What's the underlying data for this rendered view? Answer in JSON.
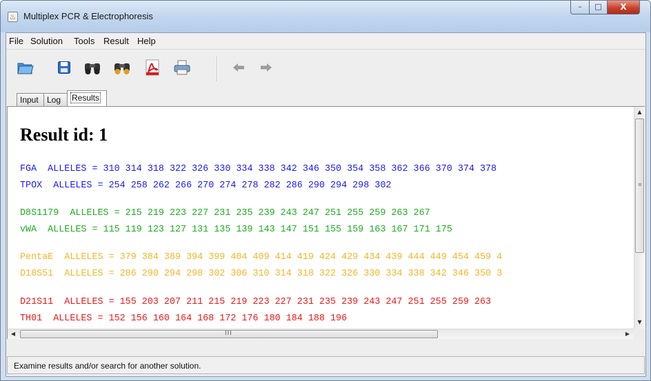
{
  "window": {
    "title": "Multiplex PCR & Electrophoresis",
    "controls": {
      "minimize": "–",
      "maximize": "□",
      "close": "X"
    }
  },
  "menubar": {
    "items": [
      {
        "label": "File"
      },
      {
        "label": "Solution"
      },
      {
        "label": "Tools"
      },
      {
        "label": "Result"
      },
      {
        "label": "Help"
      }
    ]
  },
  "toolbar": {
    "buttons": [
      {
        "icon": "open-folder-icon"
      },
      {
        "icon": "save-icon"
      },
      {
        "icon": "binoculars-icon"
      },
      {
        "icon": "binoculars-next-icon"
      },
      {
        "icon": "pdf-icon"
      },
      {
        "icon": "printer-icon"
      },
      {
        "icon": "back-arrow-icon"
      },
      {
        "icon": "forward-arrow-icon"
      }
    ]
  },
  "tabs": [
    {
      "label": "Input",
      "active": false
    },
    {
      "label": "Log",
      "active": false
    },
    {
      "label": "Results",
      "active": true
    }
  ],
  "results": {
    "heading": "Result id: 1",
    "groups": [
      {
        "color": "#1a1aff",
        "lines": [
          "FGA  ALLELES = 310 314 318 322 326 330 334 338 342 346 350 354 358 362 366 370 374 378",
          "TPOX  ALLELES = 254 258 262 266 270 274 278 282 286 290 294 298 302"
        ]
      },
      {
        "color": "#1eae1e",
        "lines": [
          "D8S1179  ALLELES = 215 219 223 227 231 235 239 243 247 251 255 259 263 267",
          "vWA  ALLELES = 115 119 123 127 131 135 139 143 147 151 155 159 163 167 171 175"
        ]
      },
      {
        "color": "#f3b62a",
        "lines": [
          "PentaE  ALLELES = 379 384 389 394 399 404 409 414 419 424 429 434 439 444 449 454 459 4",
          "D18S51  ALLELES = 286 290 294 298 302 306 310 314 318 322 326 330 334 338 342 346 350 3"
        ]
      },
      {
        "color": "#f01818",
        "lines": [
          "D21S11  ALLELES = 155 203 207 211 215 219 223 227 231 235 239 243 247 251 255 259 263",
          "TH01  ALLELES = 152 156 160 164 168 172 176 180 184 188 196"
        ]
      }
    ]
  },
  "scrollbars": {
    "up_arrow": "▲",
    "down_arrow": "▼",
    "left_arrow": "◀",
    "right_arrow": "▶",
    "h_grip": "III",
    "v_grip": "≡"
  },
  "statusbar": {
    "text": "Examine results and/or search for another solution."
  }
}
